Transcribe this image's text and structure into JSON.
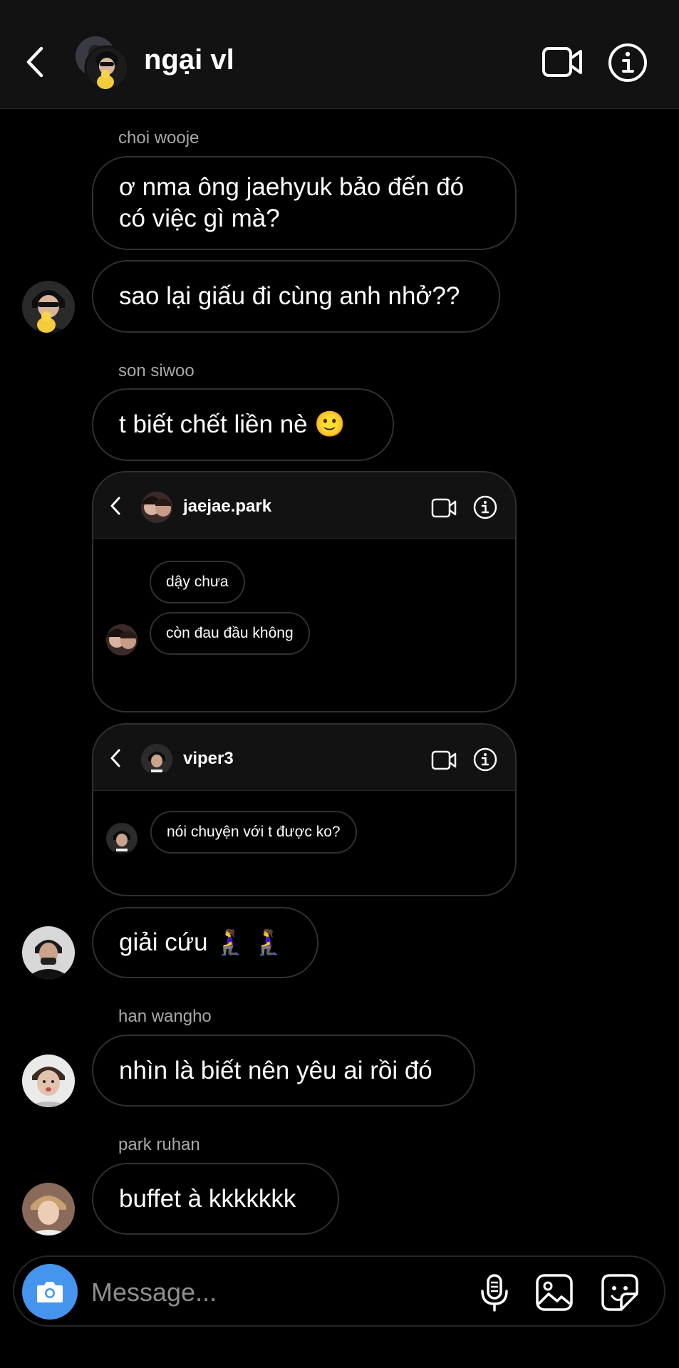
{
  "header": {
    "title": "ngại vl",
    "icons": {
      "back": "back-chevron-icon",
      "video": "video-call-icon",
      "info": "info-icon"
    }
  },
  "messages": {
    "m1": {
      "sender": "choi wooje",
      "text": "ơ nma ông jaehyuk bảo đến đó\ncó việc gì mà?"
    },
    "m2": {
      "text": "sao lại giấu đi cùng anh nhở??"
    },
    "m3": {
      "sender": "son siwoo",
      "text": "t biết chết liền nè 🙂"
    },
    "m4": {
      "text": "giải cứu 🧎‍♀️ 🧎‍♀️"
    },
    "m5": {
      "sender": "han wangho",
      "text": "nhìn là biết nên yêu ai rồi đó"
    },
    "m6": {
      "sender": "park ruhan",
      "text": "buffet à kkkkkkk"
    }
  },
  "shared_screens": {
    "s1": {
      "title": "jaejae.park",
      "msg1": "dậy chưa",
      "msg2": "còn đau đầu không"
    },
    "s2": {
      "title": "viper3",
      "msg1": "nói chuyện với t được ko?"
    }
  },
  "composer": {
    "placeholder": "Message...",
    "icons": {
      "camera": "camera-icon",
      "mic": "microphone-icon",
      "gallery": "gallery-icon",
      "sticker": "sticker-icon"
    }
  },
  "colors": {
    "background": "#000000",
    "header": "#121212",
    "bubble_border": "#303030",
    "camera_button": "#4595ef",
    "secondary_text": "#a8a8a8"
  }
}
